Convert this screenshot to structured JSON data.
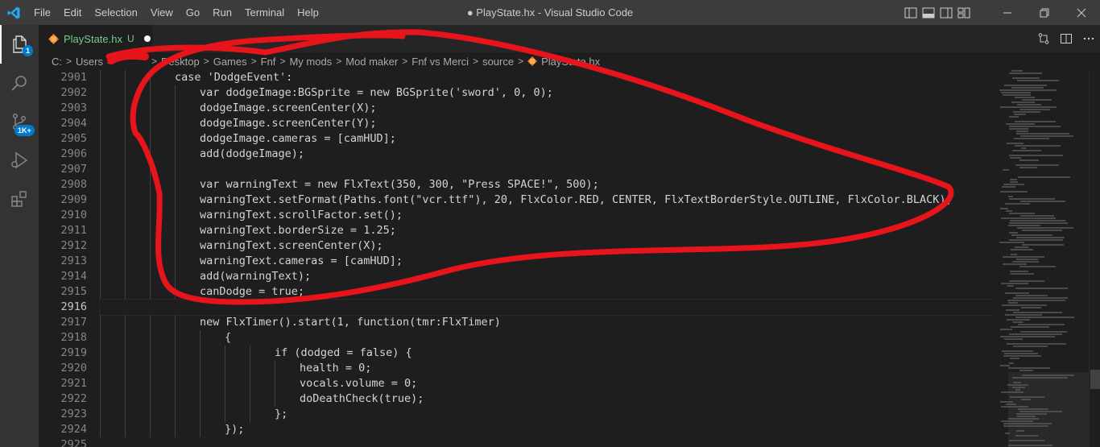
{
  "window": {
    "title": "● PlayState.hx - Visual Studio Code",
    "menu": [
      "File",
      "Edit",
      "Selection",
      "View",
      "Go",
      "Run",
      "Terminal",
      "Help"
    ]
  },
  "activity_bar": {
    "items": [
      {
        "icon": "files-icon",
        "badge": "1"
      },
      {
        "icon": "search-icon",
        "badge": ""
      },
      {
        "icon": "source-control-icon",
        "badge": "1K+"
      },
      {
        "icon": "run-debug-icon",
        "badge": ""
      },
      {
        "icon": "extensions-icon",
        "badge": ""
      }
    ]
  },
  "tab": {
    "name": "PlayState.hx",
    "status": "U"
  },
  "breadcrumb": [
    "C:",
    "Users",
    "Desktop",
    "Games",
    "Fnf",
    "My mods",
    "Mod maker",
    "Fnf vs Merci",
    "source",
    "PlayState.hx"
  ],
  "editor": {
    "lines": [
      {
        "n": "2901",
        "indent": 3,
        "text": "case 'DodgeEvent':"
      },
      {
        "n": "2902",
        "indent": 4,
        "text": "var dodgeImage:BGSprite = new BGSprite('sword', 0, 0);"
      },
      {
        "n": "2903",
        "indent": 4,
        "text": "dodgeImage.screenCenter(X);"
      },
      {
        "n": "2904",
        "indent": 4,
        "text": "dodgeImage.screenCenter(Y);"
      },
      {
        "n": "2905",
        "indent": 4,
        "text": "dodgeImage.cameras = [camHUD];"
      },
      {
        "n": "2906",
        "indent": 4,
        "text": "add(dodgeImage);"
      },
      {
        "n": "2907",
        "indent": 4,
        "text": ""
      },
      {
        "n": "2908",
        "indent": 4,
        "text": "var warningText = new FlxText(350, 300, \"Press SPACE!\", 500);"
      },
      {
        "n": "2909",
        "indent": 4,
        "text": "warningText.setFormat(Paths.font(\"vcr.ttf\"), 20, FlxColor.RED, CENTER, FlxTextBorderStyle.OUTLINE, FlxColor.BLACK);"
      },
      {
        "n": "2910",
        "indent": 4,
        "text": "warningText.scrollFactor.set();"
      },
      {
        "n": "2911",
        "indent": 4,
        "text": "warningText.borderSize = 1.25;"
      },
      {
        "n": "2912",
        "indent": 4,
        "text": "warningText.screenCenter(X);"
      },
      {
        "n": "2913",
        "indent": 4,
        "text": "warningText.cameras = [camHUD];"
      },
      {
        "n": "2914",
        "indent": 4,
        "text": "add(warningText);"
      },
      {
        "n": "2915",
        "indent": 4,
        "text": "canDodge = true;"
      },
      {
        "n": "2916",
        "indent": 0,
        "text": ""
      },
      {
        "n": "2917",
        "indent": 4,
        "text": "new FlxTimer().start(1, function(tmr:FlxTimer)"
      },
      {
        "n": "2918",
        "indent": 5,
        "text": "{"
      },
      {
        "n": "2919",
        "indent": 7,
        "text": "if (dodged = false) {"
      },
      {
        "n": "2920",
        "indent": 8,
        "text": "health = 0;"
      },
      {
        "n": "2921",
        "indent": 8,
        "text": "vocals.volume = 0;"
      },
      {
        "n": "2922",
        "indent": 8,
        "text": "doDeathCheck(true);"
      },
      {
        "n": "2923",
        "indent": 7,
        "text": "};"
      },
      {
        "n": "2924",
        "indent": 5,
        "text": "});"
      },
      {
        "n": "2925",
        "indent": 0,
        "text": ""
      }
    ],
    "active_line": "2916"
  },
  "colors": {
    "annotation": "#e8141c",
    "accent": "#007acc",
    "untracked": "#73c991"
  }
}
